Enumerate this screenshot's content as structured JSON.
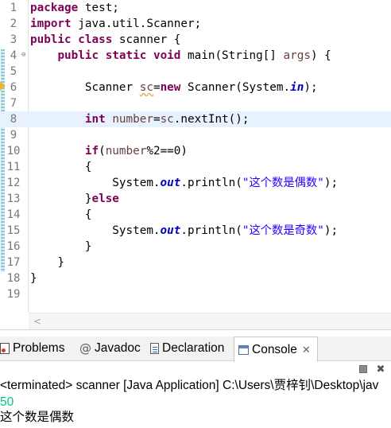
{
  "editor": {
    "lines": [
      {
        "n": "1",
        "fold": "",
        "tokens": [
          {
            "t": "package",
            "c": "kw"
          },
          {
            "t": " test;",
            "c": ""
          }
        ]
      },
      {
        "n": "2",
        "fold": "",
        "tokens": [
          {
            "t": "import",
            "c": "kw"
          },
          {
            "t": " java.util.Scanner;",
            "c": ""
          }
        ]
      },
      {
        "n": "3",
        "fold": "",
        "tokens": [
          {
            "t": "public",
            "c": "kw"
          },
          {
            "t": " ",
            "c": ""
          },
          {
            "t": "class",
            "c": "kw"
          },
          {
            "t": " scanner {",
            "c": ""
          }
        ]
      },
      {
        "n": "4",
        "fold": "⊖",
        "tokens": [
          {
            "t": "    ",
            "c": ""
          },
          {
            "t": "public",
            "c": "kw"
          },
          {
            "t": " ",
            "c": ""
          },
          {
            "t": "static",
            "c": "kw"
          },
          {
            "t": " ",
            "c": ""
          },
          {
            "t": "void",
            "c": "kw"
          },
          {
            "t": " main(String[] ",
            "c": ""
          },
          {
            "t": "args",
            "c": "var"
          },
          {
            "t": ") {",
            "c": ""
          }
        ]
      },
      {
        "n": "5",
        "fold": "",
        "tokens": []
      },
      {
        "n": "6",
        "fold": "",
        "warning": true,
        "tokens": [
          {
            "t": "        Scanner ",
            "c": ""
          },
          {
            "t": "sc",
            "c": "var warn"
          },
          {
            "t": "=",
            "c": ""
          },
          {
            "t": "new",
            "c": "kw"
          },
          {
            "t": " Scanner(System.",
            "c": ""
          },
          {
            "t": "in",
            "c": "fld"
          },
          {
            "t": ");",
            "c": ""
          }
        ]
      },
      {
        "n": "7",
        "fold": "",
        "tokens": []
      },
      {
        "n": "8",
        "fold": "",
        "current": true,
        "tokens": [
          {
            "t": "        ",
            "c": ""
          },
          {
            "t": "int",
            "c": "kw"
          },
          {
            "t": " ",
            "c": ""
          },
          {
            "t": "number",
            "c": "var"
          },
          {
            "t": "=",
            "c": ""
          },
          {
            "t": "sc",
            "c": "var"
          },
          {
            "t": ".nextInt();",
            "c": ""
          }
        ]
      },
      {
        "n": "9",
        "fold": "",
        "tokens": []
      },
      {
        "n": "10",
        "fold": "",
        "tokens": [
          {
            "t": "        ",
            "c": ""
          },
          {
            "t": "if",
            "c": "kw"
          },
          {
            "t": "(",
            "c": ""
          },
          {
            "t": "number",
            "c": "var"
          },
          {
            "t": "%2==0)",
            "c": ""
          }
        ]
      },
      {
        "n": "11",
        "fold": "",
        "tokens": [
          {
            "t": "        {",
            "c": ""
          }
        ]
      },
      {
        "n": "12",
        "fold": "",
        "tokens": [
          {
            "t": "            System.",
            "c": ""
          },
          {
            "t": "out",
            "c": "fld"
          },
          {
            "t": ".println(",
            "c": ""
          },
          {
            "t": "\"这个数是偶数\"",
            "c": "str"
          },
          {
            "t": ");",
            "c": ""
          }
        ]
      },
      {
        "n": "13",
        "fold": "",
        "tokens": [
          {
            "t": "        }",
            "c": ""
          },
          {
            "t": "else",
            "c": "kw"
          }
        ]
      },
      {
        "n": "14",
        "fold": "",
        "tokens": [
          {
            "t": "        {",
            "c": ""
          }
        ]
      },
      {
        "n": "15",
        "fold": "",
        "tokens": [
          {
            "t": "            System.",
            "c": ""
          },
          {
            "t": "out",
            "c": "fld"
          },
          {
            "t": ".println(",
            "c": ""
          },
          {
            "t": "\"这个数是奇数\"",
            "c": "str"
          },
          {
            "t": ");",
            "c": ""
          }
        ]
      },
      {
        "n": "16",
        "fold": "",
        "tokens": [
          {
            "t": "        }",
            "c": ""
          }
        ]
      },
      {
        "n": "17",
        "fold": "",
        "tokens": [
          {
            "t": "    }",
            "c": ""
          }
        ]
      },
      {
        "n": "18",
        "fold": "",
        "tokens": [
          {
            "t": "}",
            "c": ""
          }
        ]
      },
      {
        "n": "19",
        "fold": "",
        "tokens": []
      }
    ],
    "scroll_left_glyph": "<"
  },
  "panel": {
    "tabs": [
      {
        "label": "Problems",
        "icon": "problems-icon",
        "active": false
      },
      {
        "label": "Javadoc",
        "icon": "javadoc-icon",
        "active": false
      },
      {
        "label": "Declaration",
        "icon": "declaration-icon",
        "active": false
      },
      {
        "label": "Console",
        "icon": "console-icon",
        "active": true
      }
    ],
    "javadoc_glyph": "@",
    "close_glyph": "✕",
    "toolbar": {
      "terminate_glyph": "■",
      "remove_glyph": "✖"
    },
    "console": {
      "terminated_line": "<terminated> scanner [Java Application] C:\\Users\\贾梓钊\\Desktop\\jav",
      "input_line": "50",
      "output_line": "这个数是偶数"
    }
  },
  "colors": {
    "keyword": "#7f0055",
    "field": "#0000c0",
    "local_var": "#6a3e3e",
    "string": "#2a00ff",
    "console_input": "#00c87d",
    "current_line": "#e8f2fe"
  }
}
